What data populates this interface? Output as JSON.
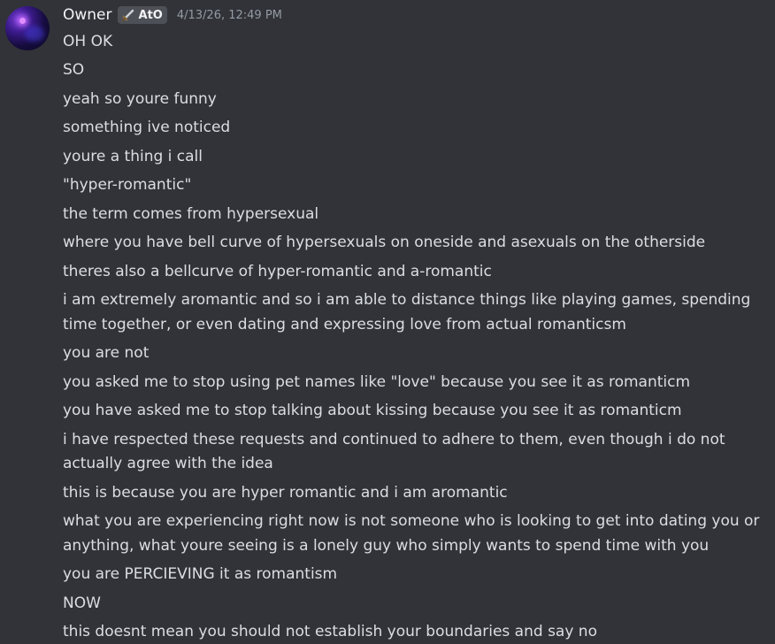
{
  "message": {
    "author": "Owner",
    "tag": {
      "text": "AtO",
      "icon": "sword-icon"
    },
    "timestamp": "4/13/26, 12:49 PM",
    "lines": [
      "OH OK",
      "SO",
      "yeah so youre funny",
      "something ive noticed",
      "youre a thing i call",
      "\"hyper-romantic\"",
      "the term comes from hypersexual",
      "where you have  bell curve of hypersexuals on oneside and asexuals on the otherside",
      "theres also a bellcurve of hyper-romantic and a-romantic",
      "i am extremely aromantic and so i am able to distance things like playing games, spending time together, or even dating and expressing love from actual romanticsm",
      "you are not",
      "you asked me to stop using pet names like \"love\" because you see it as romanticm",
      "you have asked me to stop talking about kissing because you see it as romanticm",
      "i have respected these requests and continued to adhere to them, even though i do not actually agree with the idea",
      "this is because you are hyper romantic and i am aromantic",
      "what you are experiencing right now is not someone who is looking to get into dating you or anything, what youre seeing is a lonely guy who simply wants to spend time with you",
      "you are PERCIEVING it as romantism",
      "NOW",
      "this doesnt mean you should not establish your boundaries and say no"
    ]
  },
  "colors": {
    "background": "#313338",
    "username": "#f2f3f5",
    "text": "#dbdee1",
    "timestamp": "#949ba4",
    "tag_background": "#4e5058"
  }
}
